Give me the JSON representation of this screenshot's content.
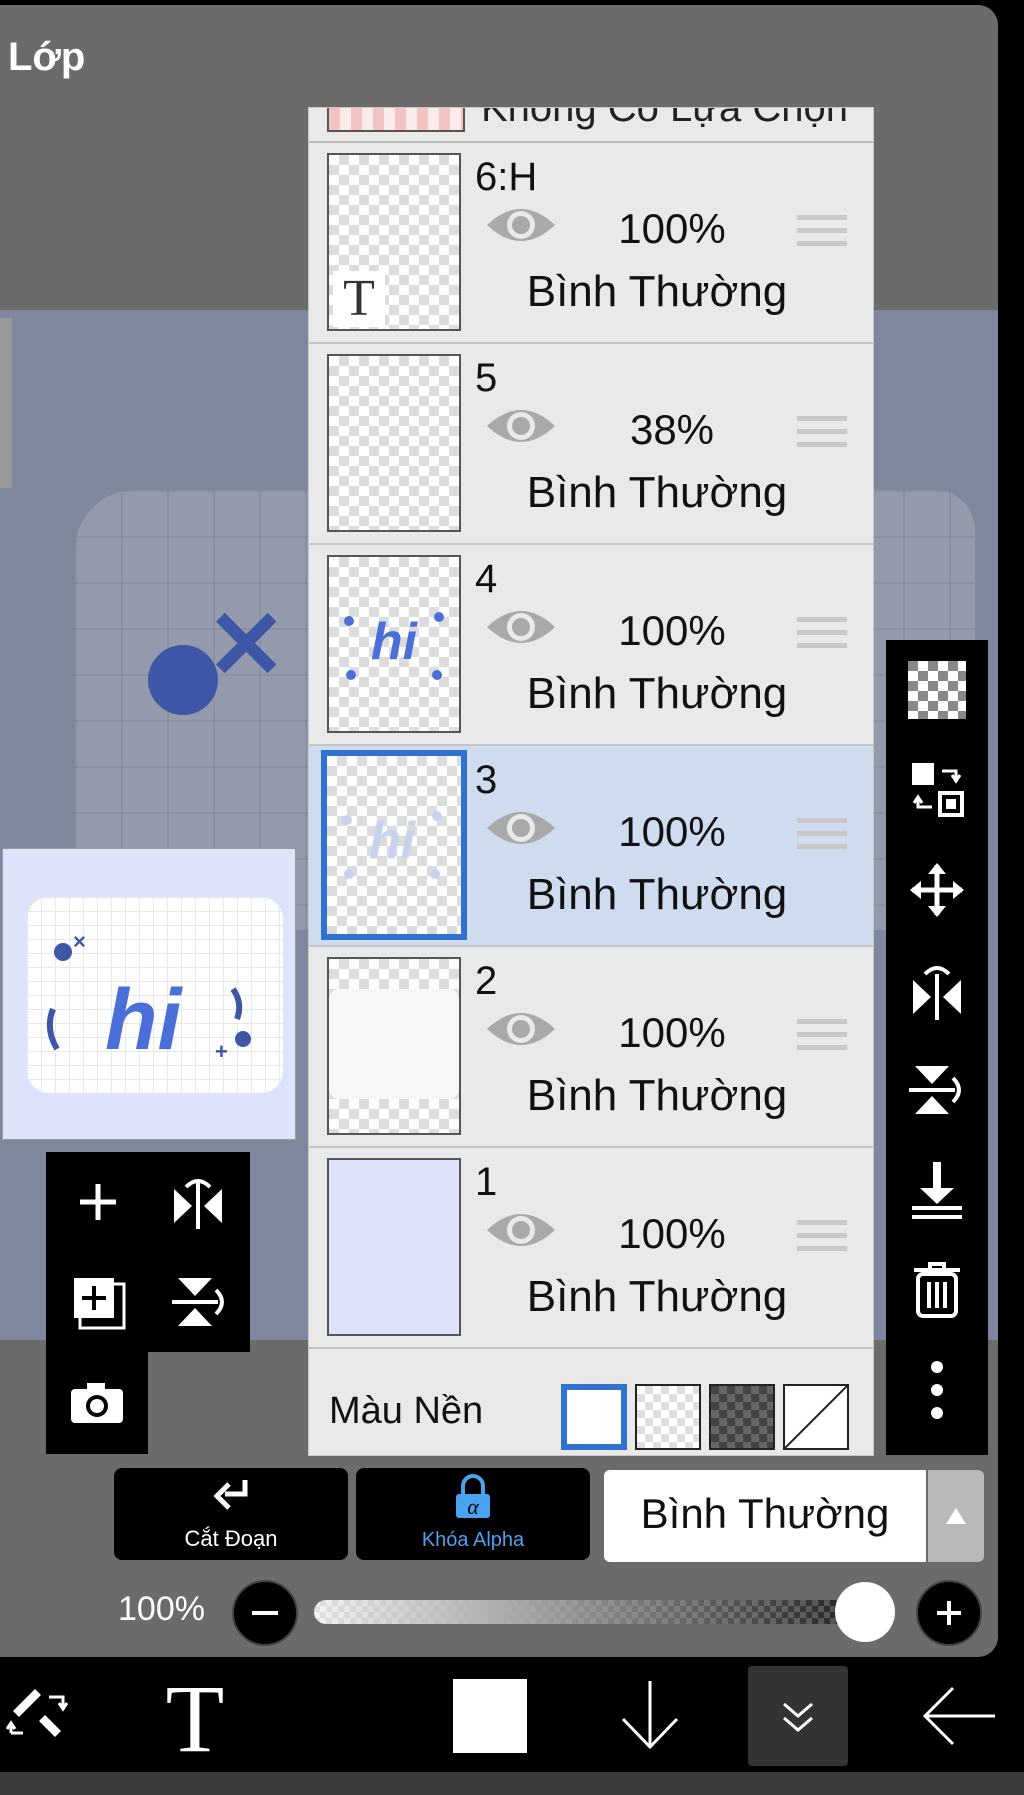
{
  "panel": {
    "title": "Lớp"
  },
  "layer_list": {
    "top_stub_label": "Không Có Lựa Chọn",
    "layers": [
      {
        "name": "6:H",
        "opacity": "100%",
        "blend": "Bình Thường",
        "selected": false,
        "kind": "text"
      },
      {
        "name": "5",
        "opacity": "38%",
        "blend": "Bình Thường",
        "selected": false,
        "kind": "empty"
      },
      {
        "name": "4",
        "opacity": "100%",
        "blend": "Bình Thường",
        "selected": false,
        "kind": "art"
      },
      {
        "name": "3",
        "opacity": "100%",
        "blend": "Bình Thường",
        "selected": true,
        "kind": "art-faint"
      },
      {
        "name": "2",
        "opacity": "100%",
        "blend": "Bình Thường",
        "selected": false,
        "kind": "paper"
      },
      {
        "name": "1",
        "opacity": "100%",
        "blend": "Bình Thường",
        "selected": false,
        "kind": "solid"
      }
    ],
    "background_label": "Màu Nền"
  },
  "thumbnail_text": {
    "t_glyph": "T",
    "hi": "hi"
  },
  "left_tools": [
    "add-layer-icon",
    "flip-horizontal-icon",
    "duplicate-layer-icon",
    "flip-vertical-icon",
    "camera-icon"
  ],
  "right_tools": [
    "transparent-icon",
    "swap-layer-icon",
    "move-icon",
    "flip-horizontal-icon",
    "flip-vertical-icon",
    "merge-down-icon",
    "trash-icon",
    "more-icon"
  ],
  "controls": {
    "clip_label": "Cắt Đoạn",
    "alpha_lock_label": "Khóa Alpha",
    "blend_mode": "Bình Thường",
    "opacity_label": "100%",
    "opacity_value": 1.0
  },
  "bottom_bar": [
    "tools-icon",
    "text-tool-icon",
    "color-swatch-icon",
    "arrow-down-icon",
    "collapse-icon",
    "back-icon"
  ],
  "colors": {
    "accent": "#2f72cf",
    "panel": "#6b6b6b",
    "alpha_lock": "#4aa3f0",
    "layer_bg": "#dce3fb",
    "art": "#3d56a6"
  }
}
